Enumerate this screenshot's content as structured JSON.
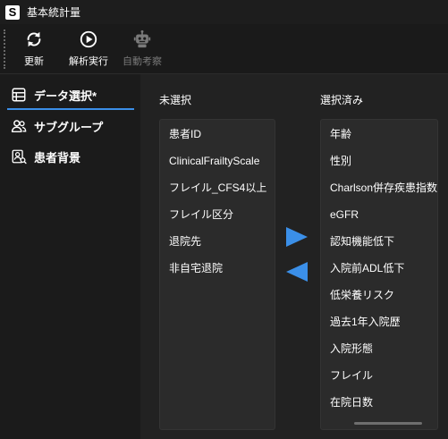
{
  "window": {
    "app_letter": "S",
    "title": "基本統計量"
  },
  "toolbar": {
    "refresh_label": "更新",
    "run_label": "解析実行",
    "auto_label": "自動考察"
  },
  "sidebar": {
    "items": [
      {
        "label": "データ選択*",
        "icon": "table-icon",
        "active": true
      },
      {
        "label": "サブグループ",
        "icon": "users-icon",
        "active": false
      },
      {
        "label": "患者背景",
        "icon": "patient-background-icon",
        "active": false
      }
    ]
  },
  "main": {
    "unselected_header": "未選択",
    "selected_header": "選択済み",
    "unselected_items": [
      "患者ID",
      "ClinicalFrailtyScale",
      "フレイル_CFS4以上",
      "フレイル区分",
      "退院先",
      "非自宅退院"
    ],
    "selected_items": [
      "年齢",
      "性別",
      "Charlson併存疾患指数",
      "eGFR",
      "認知機能低下",
      "入院前ADL低下",
      "低栄養リスク",
      "過去1年入院歴",
      "入院形態",
      "フレイル",
      "在院日数"
    ]
  },
  "colors": {
    "accent": "#3b8fe8",
    "background": "#222222",
    "listbox": "#2b2b2b"
  }
}
